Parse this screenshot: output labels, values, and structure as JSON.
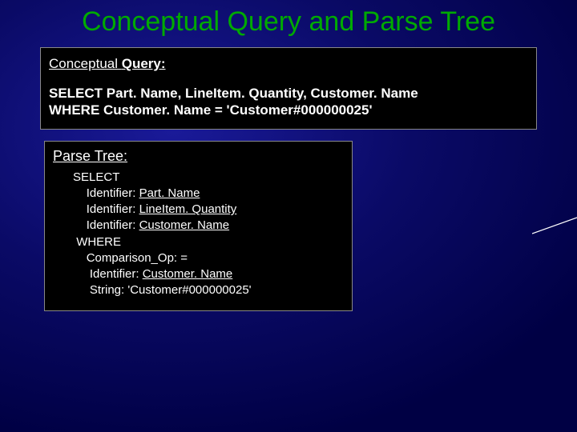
{
  "title": "Conceptual Query and Parse Tree",
  "conceptual": {
    "headingPlain": "Conceptual ",
    "headingBold": "Query:",
    "line1": "SELECT Part. Name, LineItem. Quantity, Customer. Name",
    "line2": "WHERE Customer. Name = 'Customer#000000025'"
  },
  "parse": {
    "heading": "Parse Tree:",
    "r1": "SELECT",
    "r2_label": "Identifier: ",
    "r2_val": "Part. Name",
    "r3_label": "Identifier: ",
    "r3_val": "LineItem. Quantity",
    "r4_label": "Identifier: ",
    "r4_val": "Customer. Name",
    "r5": "WHERE",
    "r6": "Comparison_Op: =",
    "r7_label": "Identifier: ",
    "r7_val": "Customer. Name",
    "r8": "String: 'Customer#000000025'"
  }
}
